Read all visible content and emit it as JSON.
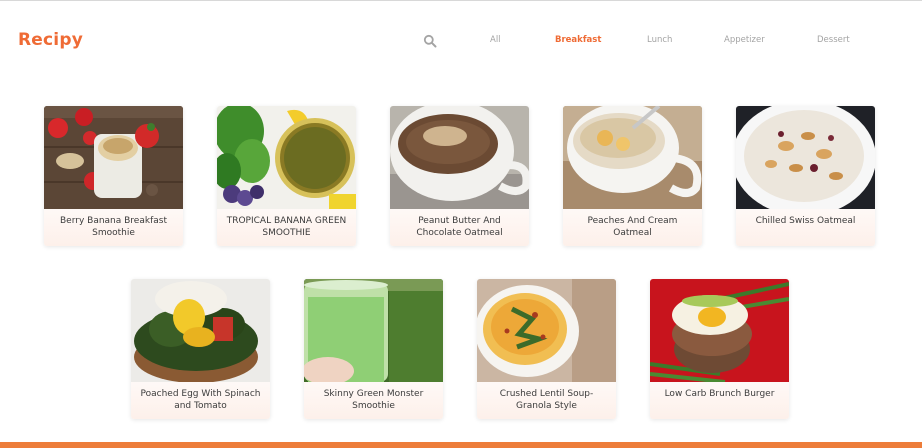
{
  "header": {
    "logo": "Recipy",
    "nav": [
      {
        "label": "All",
        "active": false
      },
      {
        "label": "Breakfast",
        "active": true
      },
      {
        "label": "Lunch",
        "active": false
      },
      {
        "label": "Appetizer",
        "active": false
      },
      {
        "label": "Dessert",
        "active": false
      }
    ]
  },
  "recipes": [
    {
      "title": "Berry Banana Breakfast Smoothie"
    },
    {
      "title": "TROPICAL BANANA GREEN SMOOTHIE"
    },
    {
      "title": "Peanut Butter And Chocolate Oatmeal"
    },
    {
      "title": "Peaches And Cream Oatmeal"
    },
    {
      "title": "Chilled Swiss Oatmeal"
    },
    {
      "title": "Poached Egg With Spinach and Tomato"
    },
    {
      "title": "Skinny Green Monster Smoothie"
    },
    {
      "title": "Crushed Lentil Soup- Granola Style"
    },
    {
      "title": "Low Carb Brunch Burger"
    }
  ],
  "colors": {
    "accent": "#ef6b35",
    "nav_inactive": "#a4a4a4",
    "footer_bar": "#ed7d3a"
  }
}
